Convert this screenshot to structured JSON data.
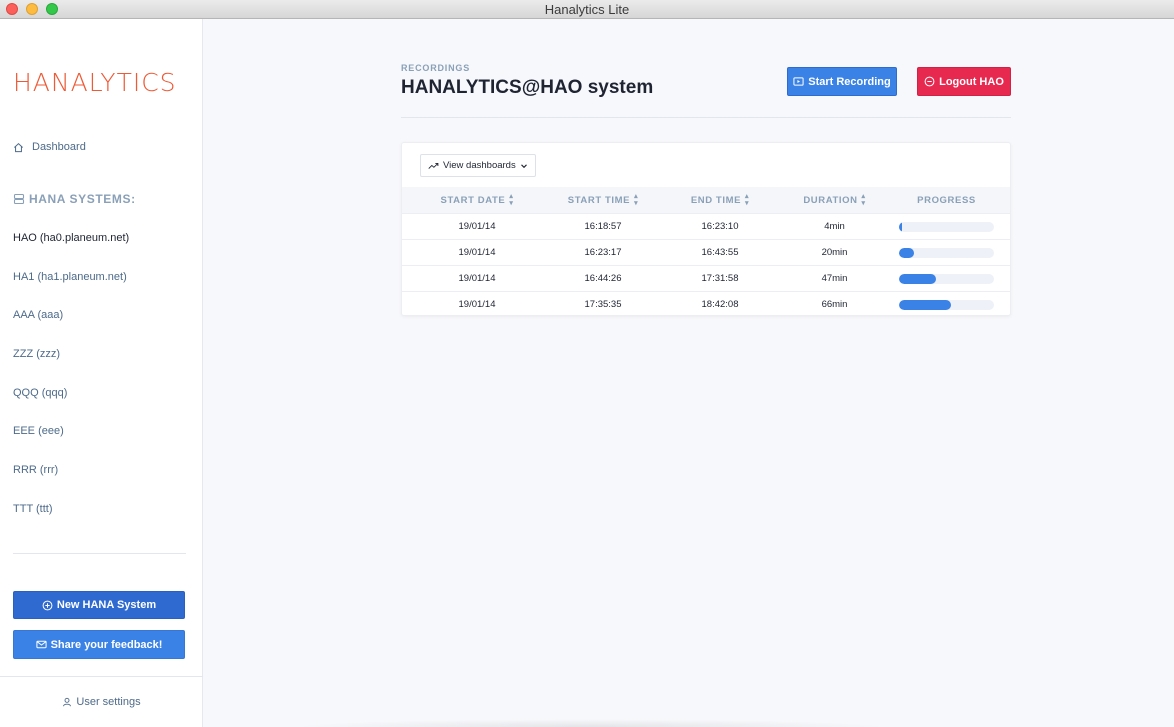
{
  "window": {
    "title": "Hanalytics Lite"
  },
  "sidebar": {
    "logo": "HANALYTICS",
    "dashboard_label": "Dashboard",
    "systems_heading": "HANA SYSTEMS:",
    "systems": [
      {
        "label": "HAO (ha0.planeum.net)",
        "active": true
      },
      {
        "label": "HA1 (ha1.planeum.net)",
        "active": false
      },
      {
        "label": "AAA (aaa)",
        "active": false
      },
      {
        "label": "ZZZ (zzz)",
        "active": false
      },
      {
        "label": "QQQ (qqq)",
        "active": false
      },
      {
        "label": "EEE (eee)",
        "active": false
      },
      {
        "label": "RRR (rrr)",
        "active": false
      },
      {
        "label": "TTT (ttt)",
        "active": false
      }
    ],
    "new_system_label": "New HANA System",
    "feedback_label": "Share your feedback!",
    "user_settings_label": "User settings"
  },
  "main": {
    "eyebrow": "RECORDINGS",
    "title": "HANALYTICS@HAO system",
    "start_recording_label": "Start Recording",
    "logout_label": "Logout HAO",
    "view_dashboards_label": "View dashboards",
    "table": {
      "headers": [
        "START DATE",
        "START TIME",
        "END TIME",
        "DURATION",
        "PROGRESS"
      ],
      "rows": [
        {
          "start_date": "19/01/14",
          "start_time": "16:18:57",
          "end_time": "16:23:10",
          "duration": "4min",
          "progress": 0.03
        },
        {
          "start_date": "19/01/14",
          "start_time": "16:23:17",
          "end_time": "16:43:55",
          "duration": "20min",
          "progress": 0.16
        },
        {
          "start_date": "19/01/14",
          "start_time": "16:44:26",
          "end_time": "17:31:58",
          "duration": "47min",
          "progress": 0.39
        },
        {
          "start_date": "19/01/14",
          "start_time": "17:35:35",
          "end_time": "18:42:08",
          "duration": "66min",
          "progress": 0.55
        }
      ]
    }
  },
  "colors": {
    "accent_blue": "#3b82e6",
    "logout_red": "#e8294f",
    "logo_orange": "#ee5a36"
  }
}
